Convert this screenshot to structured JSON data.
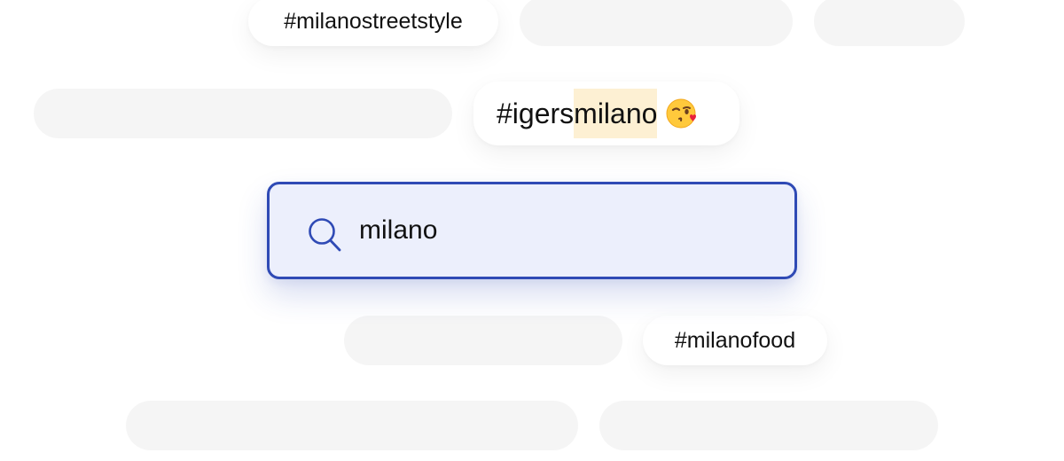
{
  "search": {
    "value": "milano",
    "icon": "search-icon",
    "accent_color": "#2f4ab5",
    "background_color": "#eceffc"
  },
  "suggestions": [
    {
      "text": "#milanostreetstyle"
    },
    {
      "prefix": "#igers",
      "match": "milano",
      "emoji": "wink-kiss-emoji"
    },
    {
      "text": "#milanofood"
    }
  ],
  "colors": {
    "placeholder": "#f5f5f5",
    "match_highlight": "#fdf0d3"
  }
}
